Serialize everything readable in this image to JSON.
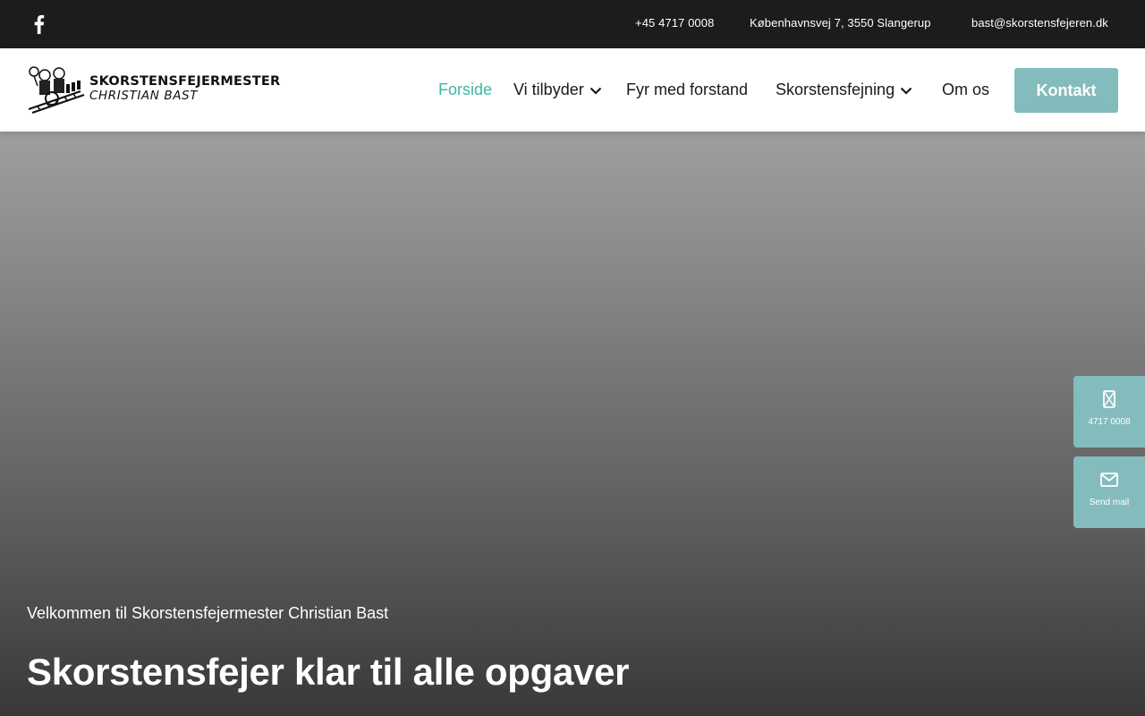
{
  "topbar": {
    "facebook_icon": "facebook-icon",
    "phone": "+45 4717 0008",
    "address": "Københavnsvej 7, 3550 Slangerup",
    "email": "bast@skorstensfejeren.dk"
  },
  "header": {
    "logo": {
      "line1": "SKORSTENSFEJERMESTER",
      "line2": "CHRISTIAN BAST"
    },
    "nav": [
      {
        "label": "Forside",
        "active": true
      },
      {
        "label": "Vi tilbyder",
        "has_dropdown": true
      },
      {
        "label": "Fyr med forstand"
      },
      {
        "label": "Skorstensfejning",
        "has_dropdown": true
      },
      {
        "label": "Om os"
      }
    ],
    "cta": "Kontakt"
  },
  "hero": {
    "welcome": "Velkommen til Skorstensfejermester Christian Bast",
    "headline": "Skorstensfejer klar til alle opgaver"
  },
  "side_buttons": {
    "phone": {
      "icon": "mobile-phone-icon",
      "label": "4717 0008"
    },
    "mail": {
      "icon": "envelope-icon",
      "label": "Send mail"
    }
  },
  "colors": {
    "accent": "#84bcbd",
    "active_nav": "#3cb8a3",
    "topbar_bg": "#1c1c1c"
  }
}
